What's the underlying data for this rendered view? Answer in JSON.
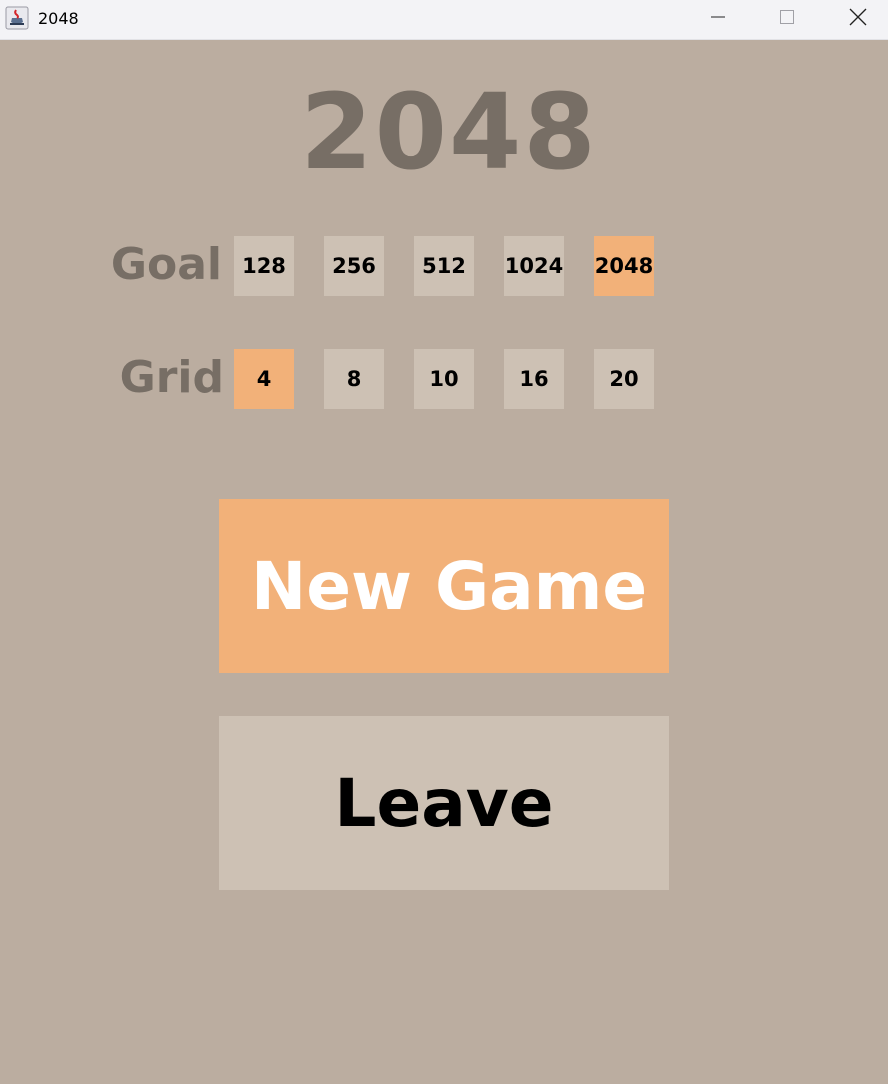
{
  "window": {
    "title": "2048",
    "app_icon": "java-cup-icon",
    "controls": [
      "minimize-icon",
      "maximize-icon",
      "close-icon"
    ]
  },
  "game": {
    "title": "2048"
  },
  "goal": {
    "label": "Goal",
    "options": [
      "128",
      "256",
      "512",
      "1024",
      "2048"
    ],
    "selected": "2048"
  },
  "grid": {
    "label": "Grid",
    "options": [
      "4",
      "8",
      "10",
      "16",
      "20"
    ],
    "selected": "4"
  },
  "buttons": {
    "new_game": "New Game",
    "leave": "Leave"
  },
  "colors": {
    "background": "#bbada0",
    "selected": "#f2b179",
    "unselected": "#cdc1b4",
    "title_text": "#776e65"
  }
}
